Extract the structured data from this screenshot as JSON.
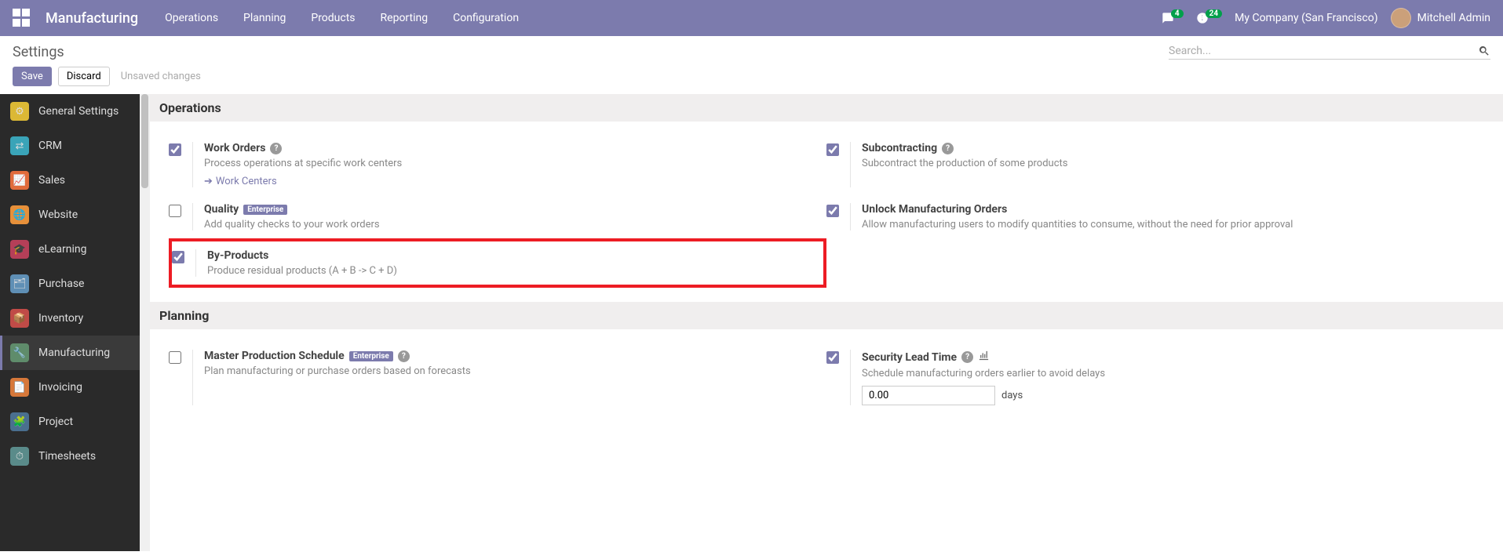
{
  "brand": "Manufacturing",
  "topnav": [
    "Operations",
    "Planning",
    "Products",
    "Reporting",
    "Configuration"
  ],
  "messages_count": "4",
  "activities_count": "24",
  "company": "My Company (San Francisco)",
  "user_name": "Mitchell Admin",
  "page_title": "Settings",
  "search_placeholder": "Search...",
  "buttons": {
    "save": "Save",
    "discard": "Discard"
  },
  "status": "Unsaved changes",
  "sidebar": [
    {
      "label": "General Settings",
      "icon_bg": "#dbb835",
      "glyph": "⚙"
    },
    {
      "label": "CRM",
      "icon_bg": "#3aa4b8",
      "glyph": "⇄"
    },
    {
      "label": "Sales",
      "icon_bg": "#e06b3c",
      "glyph": "📈"
    },
    {
      "label": "Website",
      "icon_bg": "#e6903a",
      "glyph": "🌐"
    },
    {
      "label": "eLearning",
      "icon_bg": "#b53f58",
      "glyph": "🎓"
    },
    {
      "label": "Purchase",
      "icon_bg": "#5f8fb5",
      "glyph": "🗂"
    },
    {
      "label": "Inventory",
      "icon_bg": "#c04b47",
      "glyph": "📦"
    },
    {
      "label": "Manufacturing",
      "icon_bg": "#5f8c6b",
      "glyph": "🔧",
      "active": true
    },
    {
      "label": "Invoicing",
      "icon_bg": "#d6783a",
      "glyph": "📄"
    },
    {
      "label": "Project",
      "icon_bg": "#4a6f8f",
      "glyph": "🧩"
    },
    {
      "label": "Timesheets",
      "icon_bg": "#5a8b8a",
      "glyph": "⏱"
    }
  ],
  "sections": {
    "operations": {
      "heading": "Operations",
      "items": [
        {
          "title": "Work Orders",
          "desc": "Process operations at specific work centers",
          "checked": true,
          "help": true,
          "link": "Work Centers"
        },
        {
          "title": "Subcontracting",
          "desc": "Subcontract the production of some products",
          "checked": true,
          "help": true
        },
        {
          "title": "Quality",
          "desc": "Add quality checks to your work orders",
          "checked": false,
          "enterprise": true
        },
        {
          "title": "Unlock Manufacturing Orders",
          "desc": "Allow manufacturing users to modify quantities to consume, without the need for prior approval",
          "checked": true
        },
        {
          "title": "By-Products",
          "desc": "Produce residual products (A + B -> C + D)",
          "checked": true,
          "highlighted": true
        }
      ]
    },
    "planning": {
      "heading": "Planning",
      "items": [
        {
          "title": "Master Production Schedule",
          "desc": "Plan manufacturing or purchase orders based on forecasts",
          "checked": false,
          "enterprise": true,
          "help": true
        },
        {
          "title": "Security Lead Time",
          "desc": "Schedule manufacturing orders earlier to avoid delays",
          "checked": true,
          "help": true,
          "building_icon": true,
          "input_value": "0.00",
          "input_suffix": "days"
        }
      ]
    }
  },
  "enterprise_label": "Enterprise"
}
